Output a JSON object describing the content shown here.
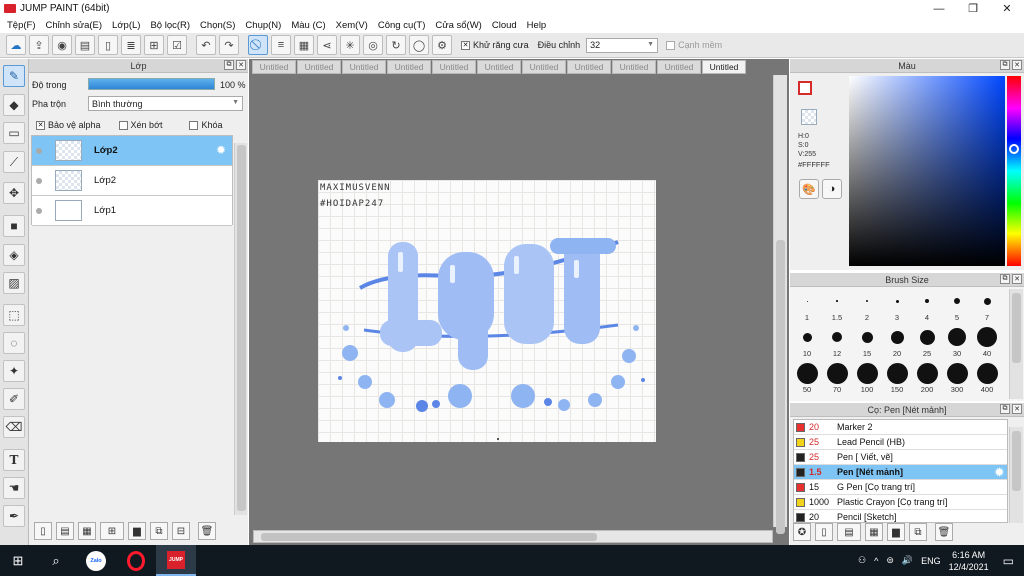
{
  "app": {
    "title": "JUMP PAINT (64bit)"
  },
  "window_controls": {
    "minimize": "—",
    "maximize": "❐",
    "close": "✕"
  },
  "menu": [
    "Tệp(F)",
    "Chỉnh sửa(E)",
    "Lớp(L)",
    "Bộ lọc(R)",
    "Chọn(S)",
    "Chụp(N)",
    "Màu (C)",
    "Xem(V)",
    "Công cụ(T)",
    "Cửa sổ(W)",
    "Cloud",
    "Help"
  ],
  "toolbar": {
    "antialias_label": "Khử răng cưa",
    "adjust_label": "Điều chỉnh",
    "adjust_value": "32",
    "sharp_label": "Cạnh mềm"
  },
  "layer_panel": {
    "title": "Lớp",
    "opacity_label": "Độ trong",
    "opacity_value": "100 %",
    "opacity_fraction": 1.0,
    "blend_label": "Pha trộn",
    "blend_value": "Bình thường",
    "protect_alpha": "Bảo vệ alpha",
    "clipping": "Xén bớt",
    "lock": "Khóa",
    "layers": [
      {
        "name": "Lớp2",
        "active": true,
        "thumb": "checker"
      },
      {
        "name": "Lớp2",
        "active": false,
        "thumb": "checker"
      },
      {
        "name": "Lớp1",
        "active": false,
        "thumb": "white"
      }
    ]
  },
  "tabs": [
    "Untitled",
    "Untitled",
    "Untitled",
    "Untitled",
    "Untitled",
    "Untitled",
    "Untitled",
    "Untitled",
    "Untitled",
    "Untitled",
    "Untitled"
  ],
  "active_tab_index": 10,
  "artwork": {
    "signature_line1": "MAXIMUSVENN",
    "signature_line2": "#HOIDAP247",
    "lettering": "LGBT",
    "accent_color": "#8fb4f2",
    "dark_accent": "#5b86e5"
  },
  "color_panel": {
    "title": "Màu",
    "fg_color": "#ffffff",
    "h": "H:0",
    "s": "S:0",
    "v": "V:255",
    "hex": "#FFFFFF"
  },
  "brush_panel": {
    "title": "Brush Size",
    "sizes": [
      "1",
      "1.5",
      "2",
      "3",
      "4",
      "5",
      "7",
      "10",
      "12",
      "15",
      "20",
      "25",
      "30",
      "40",
      "50",
      "70",
      "100",
      "150",
      "200",
      "300",
      "400"
    ]
  },
  "subtool_panel": {
    "title": "Cọ: Pen [Nét mảnh]",
    "items": [
      {
        "size": "20",
        "name": "Marker 2",
        "color": "#e8312e",
        "red": true,
        "active": false
      },
      {
        "size": "25",
        "name": "Lead Pencil (HB)",
        "color": "#f2d31b",
        "red": true,
        "active": false
      },
      {
        "size": "25",
        "name": "Pen [ Viết, vẽ]",
        "color": "#222222",
        "red": true,
        "active": false
      },
      {
        "size": "1.5",
        "name": "Pen [Nét mảnh]",
        "color": "#222222",
        "red": true,
        "active": true
      },
      {
        "size": "15",
        "name": "G Pen [Cọ trang trí]",
        "color": "#e8312e",
        "red": false,
        "active": false
      },
      {
        "size": "1000",
        "name": "Plastic Crayon [Cọ trang trí]",
        "color": "#f2d31b",
        "red": false,
        "active": false
      },
      {
        "size": "20",
        "name": "Pencil [Sketch]",
        "color": "#222222",
        "red": false,
        "active": false
      }
    ]
  },
  "taskbar": {
    "lang": "ENG",
    "time": "6:16 AM",
    "date": "12/4/2021",
    "zalo_label": "Zalo",
    "jump_label": "JUMP"
  }
}
